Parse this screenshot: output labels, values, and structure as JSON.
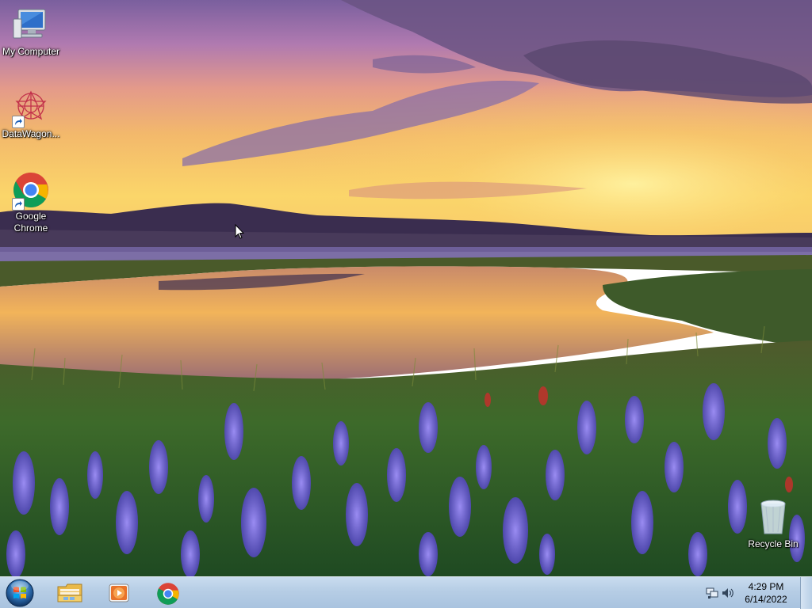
{
  "desktop": {
    "icons": [
      {
        "label": "My Computer",
        "icon": "computer-icon"
      },
      {
        "label": "DataWagon...",
        "icon": "datawagon-icon"
      },
      {
        "label": "Google Chrome",
        "icon": "chrome-icon"
      },
      {
        "label": "Recycle Bin",
        "icon": "recycle-bin-icon"
      }
    ]
  },
  "taskbar": {
    "start_icon": "windows-start-icon",
    "pinned": [
      {
        "icon": "file-explorer-icon"
      },
      {
        "icon": "media-player-icon"
      },
      {
        "icon": "chrome-icon"
      }
    ],
    "tray": {
      "network_icon": "network-icon",
      "volume_icon": "volume-icon",
      "time": "4:29 PM",
      "date": "6/14/2022"
    }
  },
  "colors": {
    "taskbar": "#b6cde5",
    "sky_gold": "#f7c85a",
    "lupine": "#6b5bd6"
  }
}
